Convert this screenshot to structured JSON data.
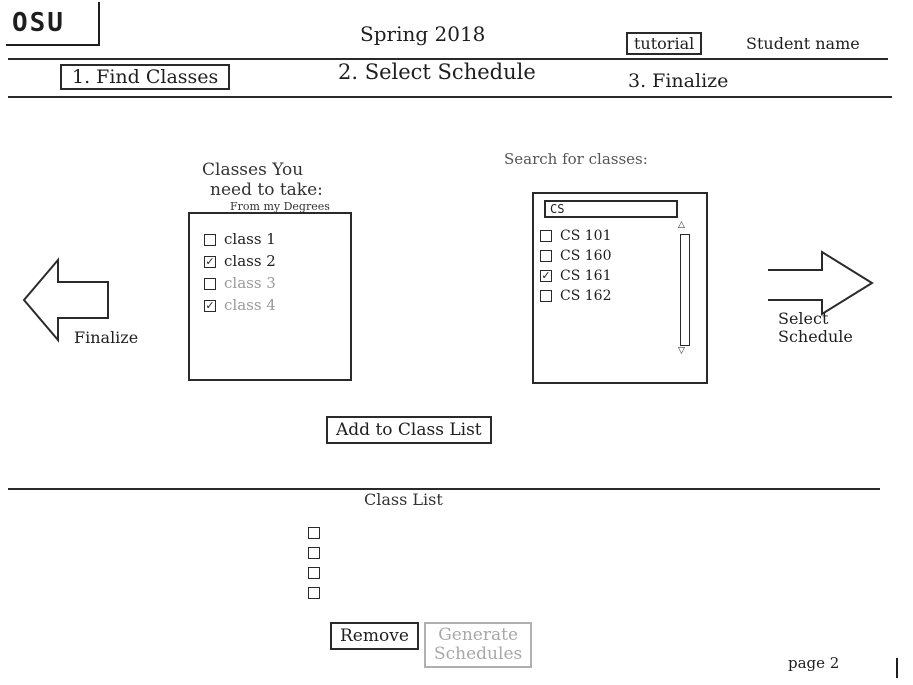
{
  "header": {
    "logo": "OSU",
    "term": "Spring 2018",
    "tutorial_label": "tutorial",
    "student_name": "Student name"
  },
  "steps": [
    {
      "label": "1. Find Classes",
      "active": true
    },
    {
      "label": "2. Select Schedule",
      "active": false
    },
    {
      "label": "3. Finalize",
      "active": false
    }
  ],
  "needed": {
    "title_line1": "Classes You",
    "title_line2": "need to take:",
    "subtitle": "From my Degrees",
    "items": [
      {
        "label": "class 1",
        "checked": false,
        "faded": false
      },
      {
        "label": "class 2",
        "checked": true,
        "faded": false
      },
      {
        "label": "class 3",
        "checked": false,
        "faded": true
      },
      {
        "label": "class 4",
        "checked": true,
        "faded": true
      }
    ]
  },
  "search": {
    "title": "Search for classes:",
    "value": "CS",
    "results": [
      {
        "label": "CS 101",
        "checked": false
      },
      {
        "label": "CS 160",
        "checked": false
      },
      {
        "label": "CS 161",
        "checked": true
      },
      {
        "label": "CS 162",
        "checked": false
      }
    ]
  },
  "nav": {
    "back_label": "Finalize",
    "next_line1": "Select",
    "next_line2": "Schedule"
  },
  "add_button": "Add to Class List",
  "class_list": {
    "title": "Class List",
    "empty_rows": 4
  },
  "actions": {
    "remove": "Remove",
    "generate_line1": "Generate",
    "generate_line2": "Schedules"
  },
  "page_label": "page 2"
}
